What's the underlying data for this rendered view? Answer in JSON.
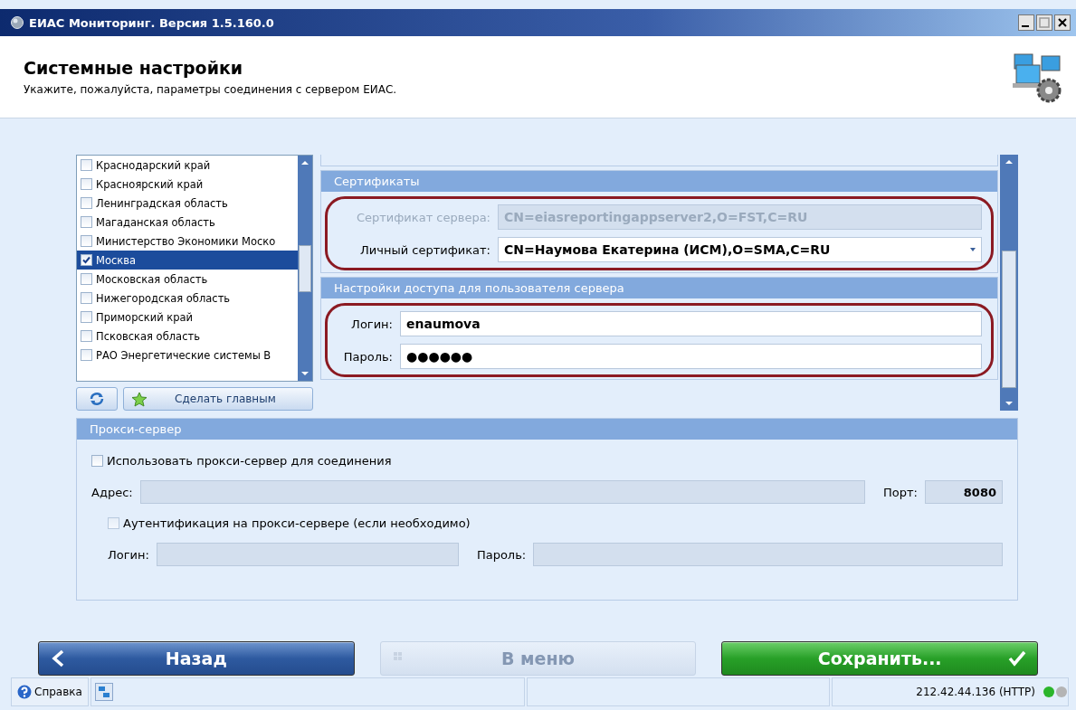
{
  "window": {
    "title": "ЕИАС Мониторинг. Версия 1.5.160.0"
  },
  "header": {
    "title": "Системные настройки",
    "subtitle": "Укажите, пожалуйста, параметры соединения с сервером ЕИАС."
  },
  "regions": {
    "items": [
      {
        "label": "Краснодарский край",
        "checked": false,
        "selected": false
      },
      {
        "label": "Красноярский край",
        "checked": false,
        "selected": false
      },
      {
        "label": "Ленинградская область",
        "checked": false,
        "selected": false
      },
      {
        "label": "Магаданская область",
        "checked": false,
        "selected": false
      },
      {
        "label": "Министерство Экономики Моско",
        "checked": false,
        "selected": false
      },
      {
        "label": "Москва",
        "checked": true,
        "selected": true
      },
      {
        "label": "Московская область",
        "checked": false,
        "selected": false
      },
      {
        "label": "Нижегородская область",
        "checked": false,
        "selected": false
      },
      {
        "label": "Приморский край",
        "checked": false,
        "selected": false
      },
      {
        "label": "Псковская область",
        "checked": false,
        "selected": false
      },
      {
        "label": "РАО Энергетические системы В",
        "checked": false,
        "selected": false
      }
    ],
    "make_main_button": "Сделать главным"
  },
  "certificates": {
    "title": "Сертификаты",
    "outlined": true,
    "fields": [
      {
        "label": "Сертификат сервера:",
        "value": "CN=eiasreportingappserver2,O=FST,C=RU",
        "disabled": true,
        "kind": "text"
      },
      {
        "label": "Личный сертификат:",
        "value": "CN=Наумова Екатерина (ИСМ),O=SMA,C=RU",
        "disabled": false,
        "kind": "dropdown"
      }
    ]
  },
  "access": {
    "title": "Настройки доступа для пользователя сервера",
    "outlined": true,
    "fields": [
      {
        "label": "Логин:",
        "value": "enaumova",
        "disabled": false
      },
      {
        "label": "Пароль:",
        "value": "●●●●●●",
        "disabled": false
      }
    ]
  },
  "proxy": {
    "title": "Прокси-сервер",
    "use_proxy": {
      "label": "Использовать прокси-сервер для соединения",
      "checked": false
    },
    "address": {
      "label": "Адрес:",
      "disabled": true
    },
    "port": {
      "label": "Порт:",
      "value": "8080",
      "disabled": true
    },
    "auth": {
      "label": "Аутентификация на прокси-сервере (если необходимо)",
      "checked": false,
      "disabled": true
    },
    "login": {
      "label": "Логин:",
      "disabled": true
    },
    "password": {
      "label": "Пароль:",
      "disabled": true
    }
  },
  "buttons": [
    {
      "kind": "back",
      "label": "Назад",
      "disabled": false
    },
    {
      "kind": "menu",
      "label": "В меню",
      "disabled": true
    },
    {
      "kind": "save",
      "label": "Сохранить...",
      "disabled": false
    }
  ],
  "status_bar": {
    "help": "Справка",
    "connection": "212.42.44.136 (HTTP)",
    "indicators": [
      {
        "color": "#2bb52b"
      },
      {
        "color": "#b4b4b4"
      }
    ]
  }
}
